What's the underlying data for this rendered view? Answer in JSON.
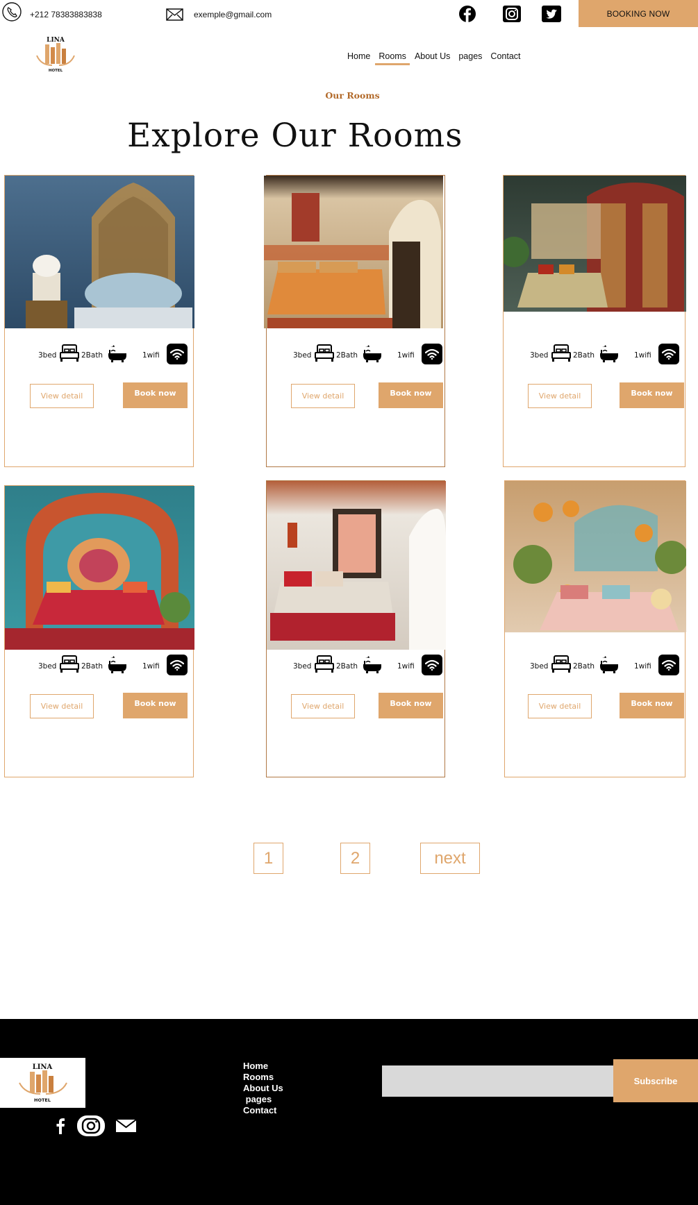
{
  "topbar": {
    "phone": "+212 78383883838",
    "email": "exemple@gmail.com",
    "booking_label": "BOOKING NOW",
    "social_icons": [
      "facebook-icon",
      "instagram-icon",
      "twitter-icon"
    ]
  },
  "brand": {
    "logo_word": "HOTEL",
    "logo_top": "LINA"
  },
  "nav": {
    "items": [
      "Home",
      "Rooms",
      "About Us",
      "pages",
      "Contact"
    ],
    "active": "Rooms"
  },
  "section": {
    "subtitle": "Our Rooms",
    "title": "Explore Our Rooms"
  },
  "rooms": [
    {
      "bed": "3bed",
      "bath": "2Bath",
      "wifi": "1wifi",
      "detail_label": "View detail",
      "book_label": "Book now"
    },
    {
      "bed": "3bed",
      "bath": "2Bath",
      "wifi": "1wifi",
      "detail_label": "View detail",
      "book_label": "Book now"
    },
    {
      "bed": "3bed",
      "bath": "2Bath",
      "wifi": "1wifi",
      "detail_label": "View detail",
      "book_label": "Book now"
    },
    {
      "bed": "3bed",
      "bath": "2Bath",
      "wifi": "1wifi",
      "detail_label": "View detail",
      "book_label": "Book now"
    },
    {
      "bed": "3bed",
      "bath": "2Bath",
      "wifi": "1wifi",
      "detail_label": "View detail",
      "book_label": "Book now"
    },
    {
      "bed": "3bed",
      "bath": "2Bath",
      "wifi": "1wifi",
      "detail_label": "View detail",
      "book_label": "Book now"
    }
  ],
  "pagination": {
    "page1": "1",
    "page2": "2",
    "next": "next"
  },
  "footer": {
    "links": [
      "Home",
      "Rooms",
      "About Us",
      " pages",
      "Contact"
    ],
    "subscribe_label": "Subscribe",
    "email_placeholder": "",
    "social_icons": [
      "facebook-icon",
      "instagram-icon",
      "mail-icon"
    ]
  },
  "colors": {
    "accent": "#dfa66c",
    "accent_dark": "#b26a2a",
    "footer_bg": "#000000"
  }
}
